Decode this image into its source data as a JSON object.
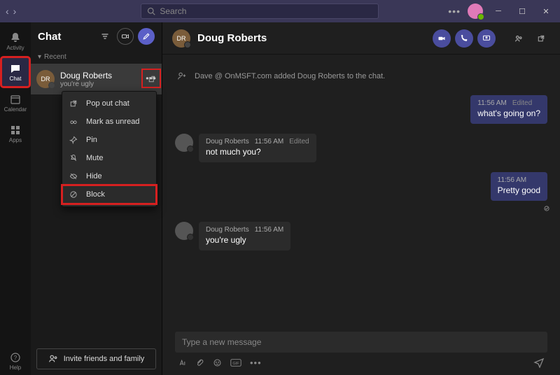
{
  "titlebar": {
    "search_placeholder": "Search"
  },
  "rail": {
    "activity": "Activity",
    "chat": "Chat",
    "calendar": "Calendar",
    "apps": "Apps",
    "help": "Help"
  },
  "sidebar": {
    "title": "Chat",
    "section": "Recent",
    "chat_item": {
      "avatar_initials": "DR",
      "name": "Doug Roberts",
      "preview": "you're ugly"
    },
    "invite": "Invite friends and family"
  },
  "context_menu": {
    "popout": "Pop out chat",
    "unread": "Mark as unread",
    "pin": "Pin",
    "mute": "Mute",
    "hide": "Hide",
    "block": "Block"
  },
  "chat": {
    "header_avatar_initials": "DR",
    "header_name": "Doug Roberts",
    "system_msg": "Dave @ OnMSFT.com added Doug Roberts to the chat.",
    "messages": [
      {
        "dir": "out",
        "time": "11:56 AM",
        "edited": "Edited",
        "text": "what's going on?"
      },
      {
        "dir": "in",
        "sender": "Doug Roberts",
        "time": "11:56 AM",
        "edited": "Edited",
        "text": "not much you?"
      },
      {
        "dir": "out",
        "time": "11:56 AM",
        "text": "Pretty good"
      },
      {
        "dir": "in",
        "sender": "Doug Roberts",
        "time": "11:56 AM",
        "text": "you're ugly"
      }
    ],
    "composer_placeholder": "Type a new message"
  }
}
